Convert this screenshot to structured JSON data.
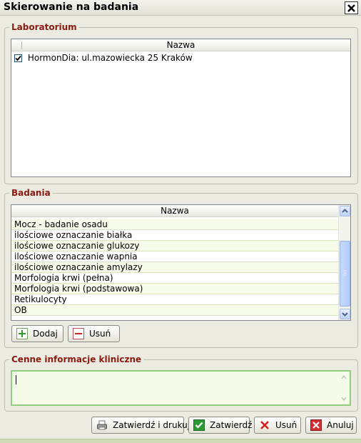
{
  "window": {
    "title": "Skierowanie na badania"
  },
  "laboratorium": {
    "legend": "Laboratorium",
    "column": "Nazwa",
    "rows": [
      {
        "label": "HormonDia: ul.mazowiecka 25 Kraków",
        "checked": true
      }
    ]
  },
  "badania": {
    "legend": "Badania",
    "column": "Nazwa",
    "rows": [
      "Mocz - badanie osadu",
      "ilościowe oznaczanie białka",
      "ilościowe oznaczanie glukozy",
      "ilościowe oznaczanie wapnia",
      "ilościowe oznaczanie amylazy",
      "Morfologia krwi (pełna)",
      "Morfologia krwi (podstawowa)",
      "Retikulocyty",
      "OB"
    ],
    "buttons": {
      "add": "Dodaj",
      "remove": "Usuń"
    }
  },
  "clinical": {
    "legend": "Cenne informacje kliniczne",
    "value": ""
  },
  "footer": {
    "confirm_print": "Zatwierdź i drukuj",
    "confirm": "Zatwierdź",
    "remove": "Usuń",
    "cancel": "Anuluj"
  },
  "colors": {
    "legend": "#8b1a10",
    "window_bg": "#ecebe2",
    "row_alt": "#f7fbea",
    "textarea_border": "#8fcf7f"
  }
}
